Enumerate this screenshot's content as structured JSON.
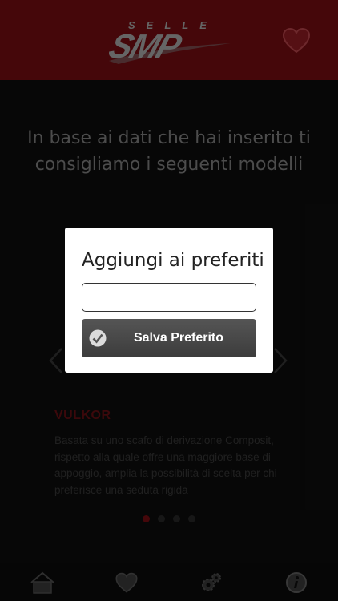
{
  "header": {
    "brand_top": "SELLE",
    "brand_main": "SMP",
    "favorite_icon": "heart-outline-icon"
  },
  "main": {
    "headline": "In base ai dati che hai inserito ti consigliamo i seguenti modelli",
    "product": {
      "name": "VULKOR",
      "description": "Basata su uno scafo di derivazione Composit, rispetto alla quale offre una maggiore base di appoggio, amplia la possibilità di scelta per chi preferisce una seduta rigida"
    },
    "pagination": {
      "total": 4,
      "active": 1
    }
  },
  "dialog": {
    "title": "Aggiungi ai preferiti",
    "input_value": "",
    "save_label": "Salva Preferito"
  },
  "tabbar": {
    "items": [
      {
        "icon": "home-icon"
      },
      {
        "icon": "heart-icon"
      },
      {
        "icon": "gears-icon"
      },
      {
        "icon": "info-icon"
      }
    ]
  },
  "colors": {
    "brand_red": "#7e0d13",
    "background": "#0e0e0e",
    "logo_grey": "#b9b9b9"
  }
}
